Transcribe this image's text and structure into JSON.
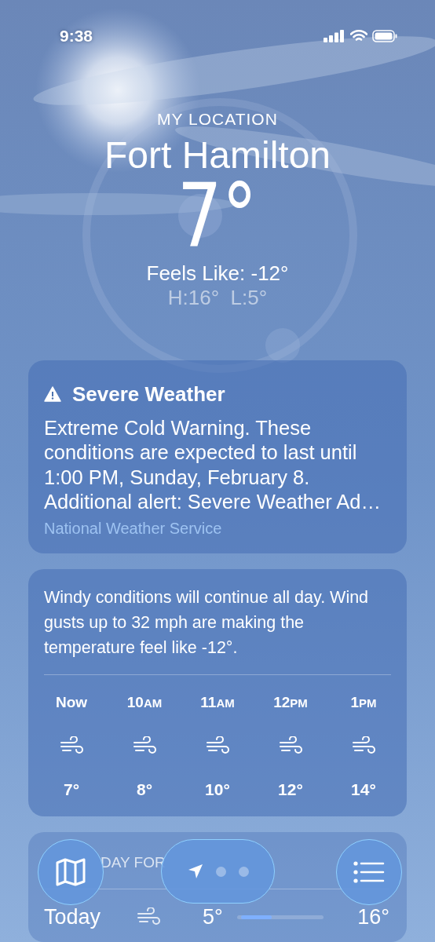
{
  "status_bar": {
    "time": "9:38"
  },
  "header": {
    "location_label": "MY LOCATION",
    "city": "Fort Hamilton",
    "temperature": "7°",
    "feels_like": "Feels Like: -12°",
    "high_low": "H:16°  L:5°"
  },
  "alert": {
    "title": "Severe Weather",
    "text": "Extreme Cold Warning. These conditions are expected to last until 1:00 PM, Sunday, February 8. Additional alert: Severe Weather Ad…",
    "source": "National Weather Service"
  },
  "hourly": {
    "summary": "Windy conditions will continue all day. Wind gusts up to 32 mph are making the temperature feel like -12°.",
    "hours": [
      {
        "hour": "Now",
        "temp": "7°"
      },
      {
        "hour": "10",
        "period": "AM",
        "temp": "8°"
      },
      {
        "hour": "11",
        "period": "AM",
        "temp": "10°"
      },
      {
        "hour": "12",
        "period": "PM",
        "temp": "12°"
      },
      {
        "hour": "1",
        "period": "PM",
        "temp": "14°"
      }
    ]
  },
  "forecast": {
    "heading": "DAY FOR",
    "days": [
      {
        "day": "Today",
        "low": "5°",
        "high": "16°",
        "level": 0.35
      }
    ]
  },
  "page_dots": [
    {
      "kind": "location",
      "selected": true
    },
    {
      "kind": "dot",
      "selected": false
    },
    {
      "kind": "dot",
      "selected": false
    }
  ]
}
